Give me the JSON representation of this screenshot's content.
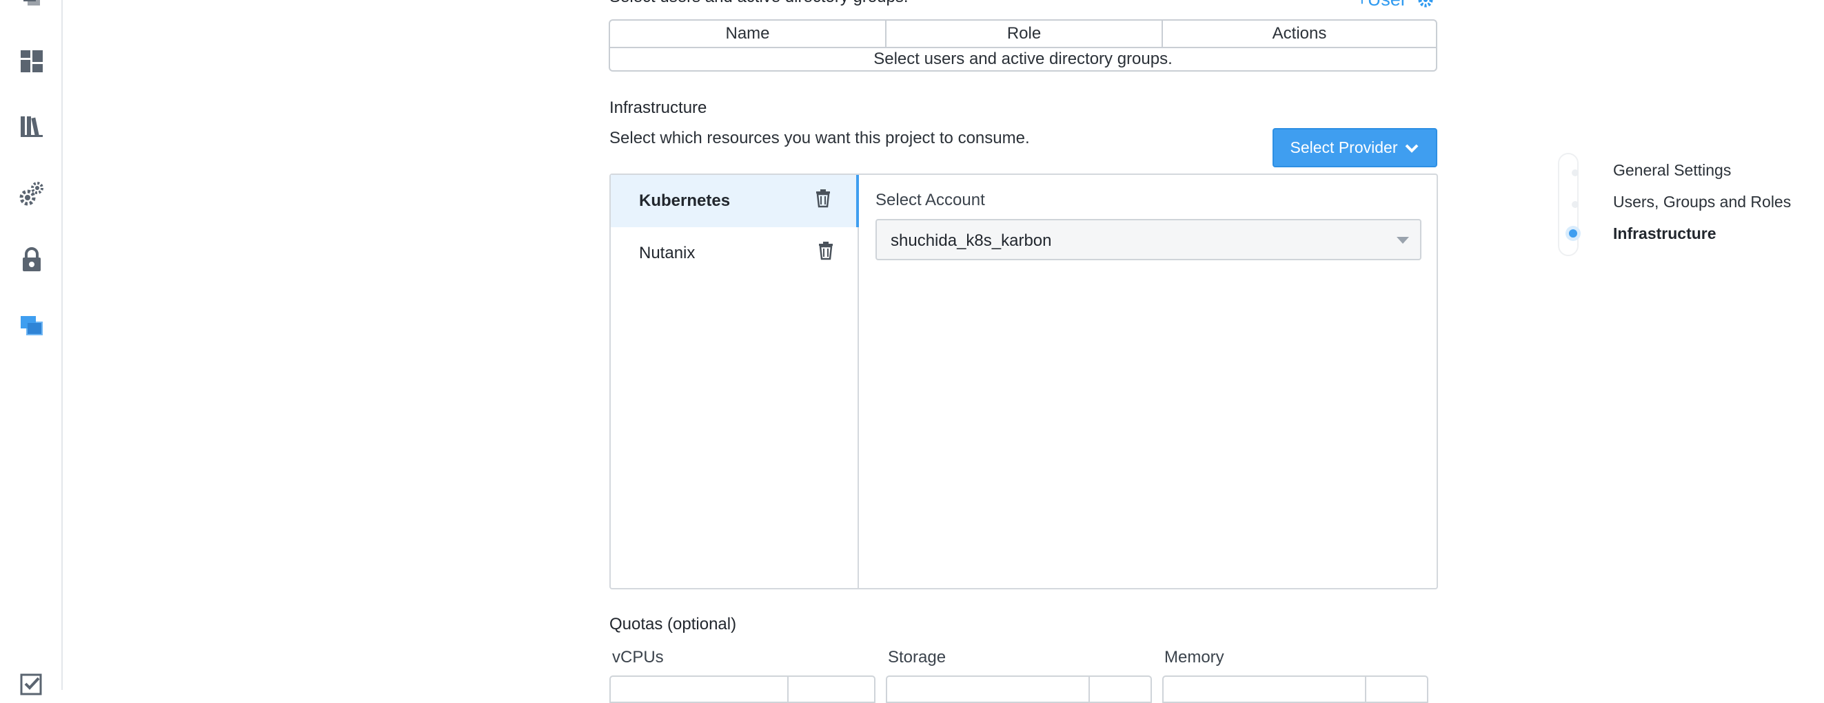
{
  "sidebar": {
    "icons": [
      "projects-top-icon",
      "dashboard-icon",
      "library-icon",
      "settings-gears-icon",
      "lock-gear-icon",
      "projects-icon",
      "checklist-icon"
    ]
  },
  "users_section": {
    "intro": "Select users and active directory groups.",
    "add_user_link": "+User",
    "table": {
      "columns": [
        "Name",
        "Role",
        "Actions"
      ],
      "empty_message": "Select users and active directory groups."
    }
  },
  "infrastructure": {
    "title": "Infrastructure",
    "description": "Select which resources you want this project to consume.",
    "select_provider_label": "Select Provider",
    "providers": [
      {
        "name": "Kubernetes",
        "active": true
      },
      {
        "name": "Nutanix",
        "active": false
      }
    ],
    "account": {
      "label": "Select Account",
      "value": "shuchida_k8s_karbon"
    }
  },
  "quotas": {
    "title": "Quotas (optional)",
    "fields": [
      "vCPUs",
      "Storage",
      "Memory"
    ]
  },
  "steps": [
    {
      "label": "General Settings",
      "active": false
    },
    {
      "label": "Users, Groups and Roles",
      "active": false
    },
    {
      "label": "Infrastructure",
      "active": true
    }
  ],
  "colors": {
    "accent": "#3f9ef0",
    "active_row": "#e8f3fd",
    "border": "#d4d8dd"
  }
}
